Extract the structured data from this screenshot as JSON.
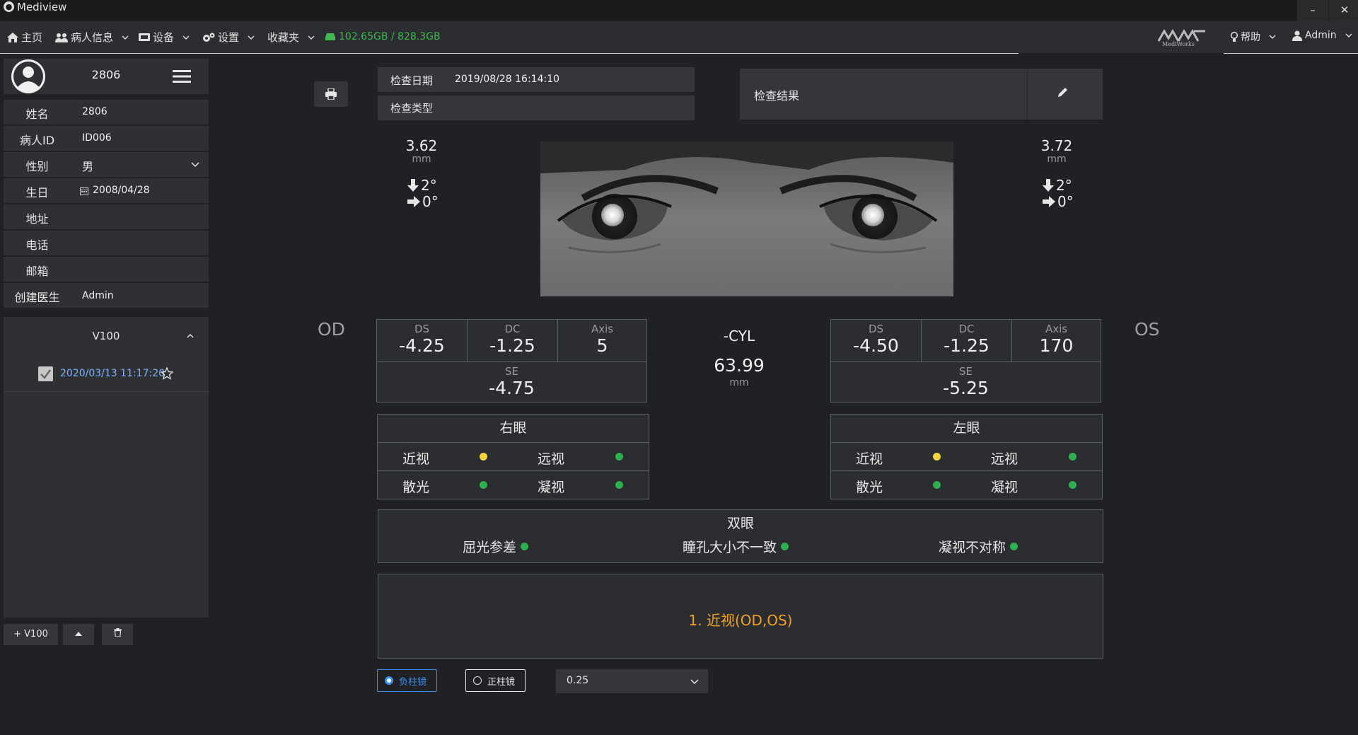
{
  "window": {
    "title": "Mediview",
    "minimize": "–",
    "close": "✕"
  },
  "menu": {
    "home": "主页",
    "patient_info": "病人信息",
    "device": "设备",
    "settings": "设置",
    "favorites": "收藏夹",
    "storage": "102.65GB / 828.3GB",
    "logo_text": "MediWorks",
    "help": "帮助",
    "user": "Admin"
  },
  "patient": {
    "number": "2806",
    "fields": [
      {
        "label": "姓名",
        "value": "2806"
      },
      {
        "label": "病人ID",
        "value": "ID006"
      },
      {
        "label": "性别",
        "value": "男"
      },
      {
        "label": "生日",
        "value": "2008/04/28"
      },
      {
        "label": "地址",
        "value": ""
      },
      {
        "label": "电话",
        "value": ""
      },
      {
        "label": "邮箱",
        "value": ""
      },
      {
        "label": "创建医生",
        "value": "Admin"
      }
    ]
  },
  "visits": {
    "device": "V100",
    "items": [
      {
        "date": "2020/03/13 11:17:20"
      }
    ],
    "add_label": "+ V100"
  },
  "exam": {
    "date_label": "检查日期",
    "date_value": "2019/08/28 16:14:10",
    "type_label": "检查类型",
    "type_value": "",
    "result_label": "检查结果"
  },
  "od": {
    "label": "OD",
    "pupil": "3.62",
    "pupil_unit": "mm",
    "angle_vertical": "2°",
    "angle_horizontal": "0°",
    "ds_label": "DS",
    "ds": "-4.25",
    "dc_label": "DC",
    "dc": "-1.25",
    "axis_label": "Axis",
    "axis": "5",
    "se_label": "SE",
    "se": "-4.75",
    "conditions_title": "右眼",
    "conditions": [
      {
        "name": "近视",
        "status": "yellow"
      },
      {
        "name": "远视",
        "status": "green"
      },
      {
        "name": "散光",
        "status": "green"
      },
      {
        "name": "凝视",
        "status": "green"
      }
    ]
  },
  "os": {
    "label": "OS",
    "pupil": "3.72",
    "pupil_unit": "mm",
    "angle_vertical": "2°",
    "angle_horizontal": "0°",
    "ds_label": "DS",
    "ds": "-4.50",
    "dc_label": "DC",
    "dc": "-1.25",
    "axis_label": "Axis",
    "axis": "170",
    "se_label": "SE",
    "se": "-5.25",
    "conditions_title": "左眼",
    "conditions": [
      {
        "name": "近视",
        "status": "yellow"
      },
      {
        "name": "远视",
        "status": "green"
      },
      {
        "name": "散光",
        "status": "green"
      },
      {
        "name": "凝视",
        "status": "green"
      }
    ]
  },
  "center": {
    "cyl_label": "-CYL",
    "pd": "63.99",
    "pd_unit": "mm"
  },
  "both_eyes": {
    "title": "双眼",
    "items": [
      {
        "name": "屈光参差",
        "status": "green"
      },
      {
        "name": "瞳孔大小不一致",
        "status": "green"
      },
      {
        "name": "凝视不对称",
        "status": "green"
      }
    ]
  },
  "diagnosis": "1. 近视(OD,OS)",
  "options": {
    "negative_cyl": "负柱镜",
    "positive_cyl": "正柱镜",
    "selected": "负柱镜",
    "step": "0.25"
  },
  "colors": {
    "accent_blue": "#3b8ff0",
    "status_green": "#2db052",
    "status_yellow": "#f2d23c",
    "diagnosis_orange": "#f0a020",
    "storage_green": "#3fb950"
  }
}
